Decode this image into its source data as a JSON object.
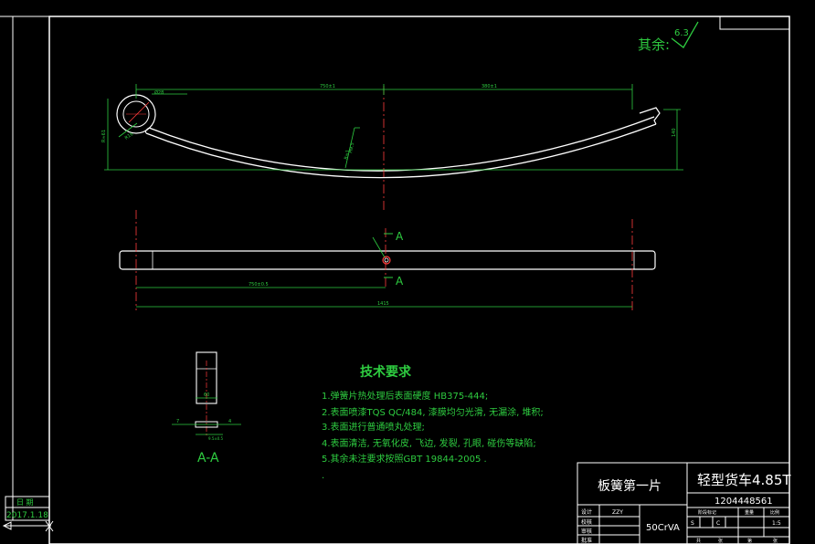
{
  "roughness": {
    "label": "其余:",
    "value": "6.3"
  },
  "dimensions": {
    "top_left_span": "750±1",
    "top_right_span": "380±1",
    "left_height": "R≈61",
    "eye_dia": "Ø28",
    "eye_r": "R16",
    "camber_mark": "R≈1",
    "mid_thick": "H9.5",
    "right_height": "140",
    "plan_left": "750±0.5",
    "plan_total": "1415"
  },
  "section": {
    "mark": "A",
    "view_label": "A-A",
    "width": "60",
    "thk": "7",
    "side": "4",
    "sub": "9.5±0.5"
  },
  "tech_requirements": {
    "title": "技术要求",
    "items": [
      "1.弹簧片热处理后表面硬度 HB375-444;",
      "2.表面喷漆TQS QC/484, 漆膜均匀光滑, 无漏涂, 堆积;",
      "3.表面进行普通喷丸处理;",
      "4.表面清洁, 无氧化皮, 飞边, 发裂, 孔眼, 碰伤等缺陷;",
      "5.其余未注要求按照GBT 19844-2005 .",
      "."
    ]
  },
  "title_block": {
    "part_name": "板簧第一片",
    "product": "轻型货车4.85T",
    "drawing_no": "1204448561",
    "material": "50CrVA",
    "rows": [
      {
        "label": "设计",
        "value": "ZZY"
      },
      {
        "label": "校核",
        "value": ""
      },
      {
        "label": "审核",
        "value": ""
      },
      {
        "label": "批准",
        "value": ""
      }
    ],
    "col_heads": [
      "阶段标记",
      "重量",
      "比例"
    ],
    "stage_cells": [
      "S",
      "",
      "C"
    ],
    "scale": "1:5",
    "sheet_text": [
      "共",
      "张",
      "第",
      "张"
    ]
  },
  "side_block": {
    "label": "日 期",
    "date": "2017.1.18"
  }
}
